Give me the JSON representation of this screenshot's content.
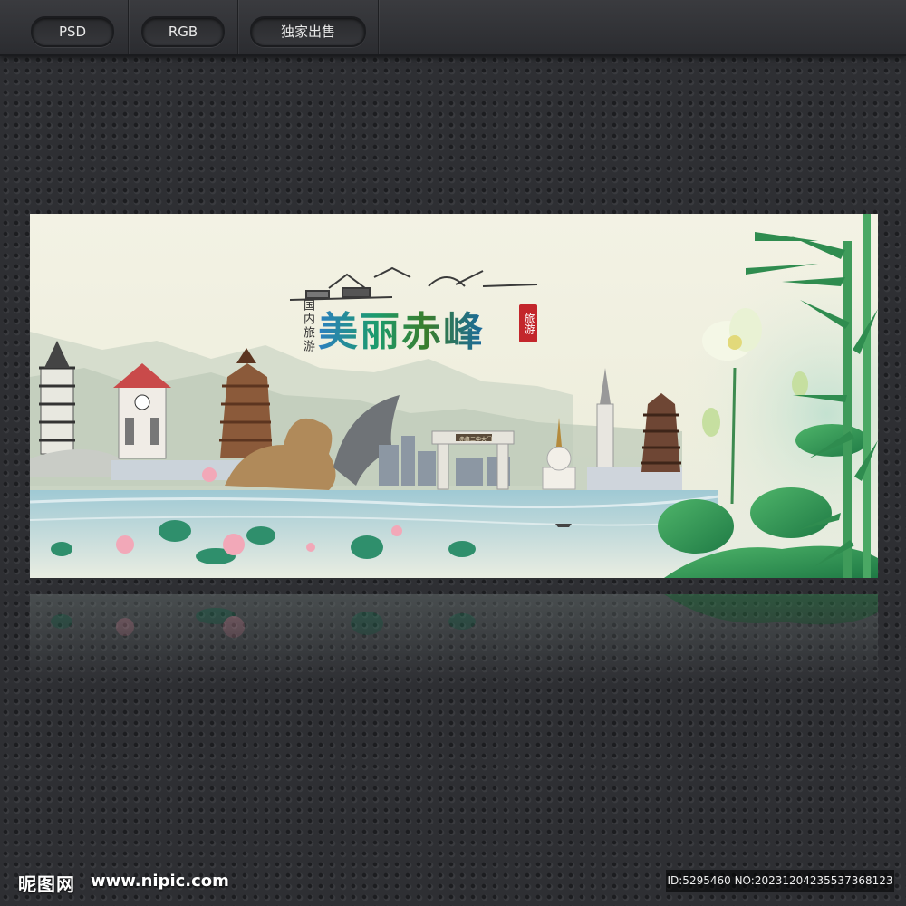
{
  "toolbar": {
    "buttons": [
      {
        "label": "PSD"
      },
      {
        "label": "RGB"
      },
      {
        "label": "独家出售"
      }
    ]
  },
  "poster": {
    "title": "美丽赤峰",
    "left_vertical": "国内旅游",
    "stamp": "旅游",
    "gate_plaque": "赤峰三中大门"
  },
  "footer": {
    "logo_text": "昵图网",
    "url": "www.nipic.com",
    "id_text": "ID:5295460 NO:20231204235537368123"
  },
  "colors": {
    "page_bg": "#2e2f33",
    "title_blue": "#2d7fc1",
    "title_green": "#1c9b6c",
    "stamp_red": "#c3262b"
  }
}
